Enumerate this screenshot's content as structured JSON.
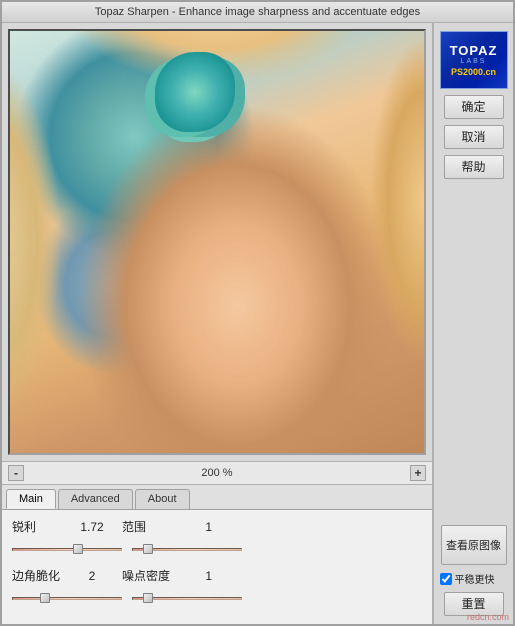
{
  "window": {
    "title": "Topaz Sharpen - Enhance image sharpness and accentuate edges"
  },
  "logo": {
    "topaz": "TOPAZ",
    "labs": "LABS",
    "ps": "PS2000.cn"
  },
  "buttons": {
    "confirm": "确定",
    "cancel": "取消",
    "help": "帮助",
    "view_original": "查看原图像",
    "smooth_faster": "平稳更快",
    "reset": "重置"
  },
  "zoom": {
    "minus": "-",
    "value": "200 %",
    "plus": "+"
  },
  "tabs": {
    "main": "Main",
    "advanced": "Advanced",
    "about": "About"
  },
  "params": {
    "sharpen_label": "锐利",
    "sharpen_value": "1.72",
    "range_label": "范围",
    "range_value": "1",
    "corner_label": "边角脆化",
    "corner_value": "2",
    "noise_label": "噪点密度",
    "noise_value": "1"
  },
  "brand": "redcn.com"
}
